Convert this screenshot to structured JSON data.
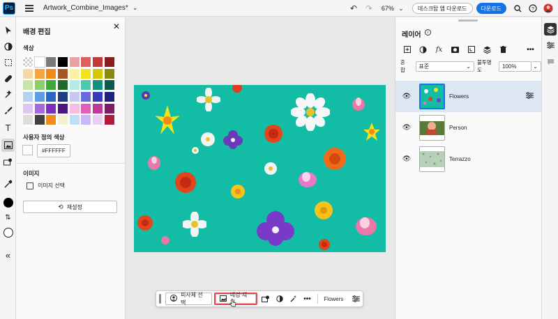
{
  "app": {
    "logo_text": "Ps",
    "doc_title": "Artwork_Combine_Images*",
    "zoom": "67%",
    "desktop_btn": "데스크탑 앱 다운로드",
    "download_btn": "다운로드"
  },
  "edit_panel": {
    "title": "배경 편집",
    "color_label": "색상",
    "colors": [
      "checker",
      "#ffffff",
      "#7a7a7a",
      "#000000",
      "#e8a2a2",
      "#e06060",
      "#c43838",
      "#8b1d1d",
      "#f5d7a8",
      "#f5a43f",
      "#f08a1a",
      "#a8571e",
      "#faf2a0",
      "#f4e21b",
      "#d6c800",
      "#8a8a10",
      "#c7e5a8",
      "#8ccf6a",
      "#3aa83a",
      "#1f6b2c",
      "#b3ebe2",
      "#49c9b2",
      "#159080",
      "#0c5a4e",
      "#b3d2ef",
      "#5c9ce4",
      "#2a65c4",
      "#1b3e80",
      "#c8c8f5",
      "#6a6ae0",
      "#3838c0",
      "#1f1f80",
      "#dcc7f0",
      "#a46ad8",
      "#7a2fbf",
      "#4c1580",
      "#f5bde4",
      "#e060b8",
      "#c03898",
      "#801c65",
      "#dcdcdc",
      "#404040",
      "#f08a1a",
      "#f4f0d0",
      "#bde0f5",
      "#c8b8f5",
      "#e8d0f0",
      "#b01c3e"
    ],
    "custom_label": "사용자 정의 색상",
    "custom_hex": "#FFFFFF",
    "image_label": "이미지",
    "image_select": "이미지 선택",
    "reset": "재설정"
  },
  "floating_bar": {
    "select_subject": "피사체 선택",
    "remove_bg": "배경 제거",
    "layer_name": "Flowers"
  },
  "layers_panel": {
    "title": "레이어",
    "blend_label": "혼합",
    "blend_value": "표준",
    "opacity_label": "불투명도",
    "opacity_value": "100%",
    "layers": [
      {
        "name": "Flowers"
      },
      {
        "name": "Person"
      },
      {
        "name": "Terrazzo"
      }
    ]
  }
}
